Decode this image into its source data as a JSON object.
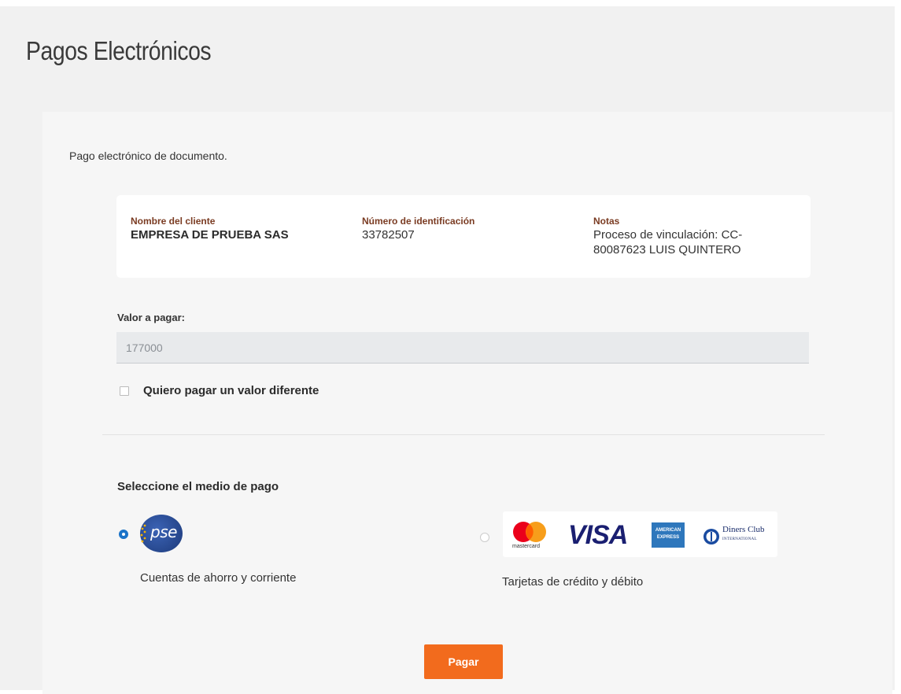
{
  "page": {
    "title": "Pagos Electrónicos"
  },
  "panel": {
    "subtitle": "Pago electrónico de documento."
  },
  "client_info": {
    "name_label": "Nombre del cliente",
    "name_value": "EMPRESA DE PRUEBA SAS",
    "id_label": "Número de identificación",
    "id_value": "33782507",
    "notes_label": "Notas",
    "notes_value_line1": "Proceso de vinculación: CC-",
    "notes_value_line2": "80087623 LUIS QUINTERO"
  },
  "amount": {
    "label": "Valor a pagar:",
    "value": "177000",
    "checkbox_label": "Quiero pagar un valor diferente",
    "checkbox_checked": false
  },
  "payment_methods": {
    "title": "Seleccione el medio de pago",
    "options": [
      {
        "logo_text": "pse",
        "caption": "Cuentas de ahorro y corriente",
        "selected": true
      },
      {
        "logos": [
          "mastercard",
          "VISA",
          "AMERICAN EXPRESS",
          "Diners Club INTERNATIONAL"
        ],
        "caption": "Tarjetas de crédito y débito",
        "selected": false
      }
    ],
    "mastercard_text": "mastercard",
    "visa_text": "VISA",
    "amex_line1": "AMERICAN",
    "amex_line2": "EXPRESS",
    "diners_line1": "Diners Club",
    "diners_line2": "INTERNATIONAL"
  },
  "actions": {
    "pay_label": "Pagar"
  },
  "colors": {
    "accent_orange": "#f26b1d",
    "label_brown": "#7a3b22",
    "radio_blue": "#1a73c8",
    "pse_blue": "#1d3a7a",
    "visa_blue": "#1a1f71",
    "amex_blue": "#2e77bc"
  }
}
